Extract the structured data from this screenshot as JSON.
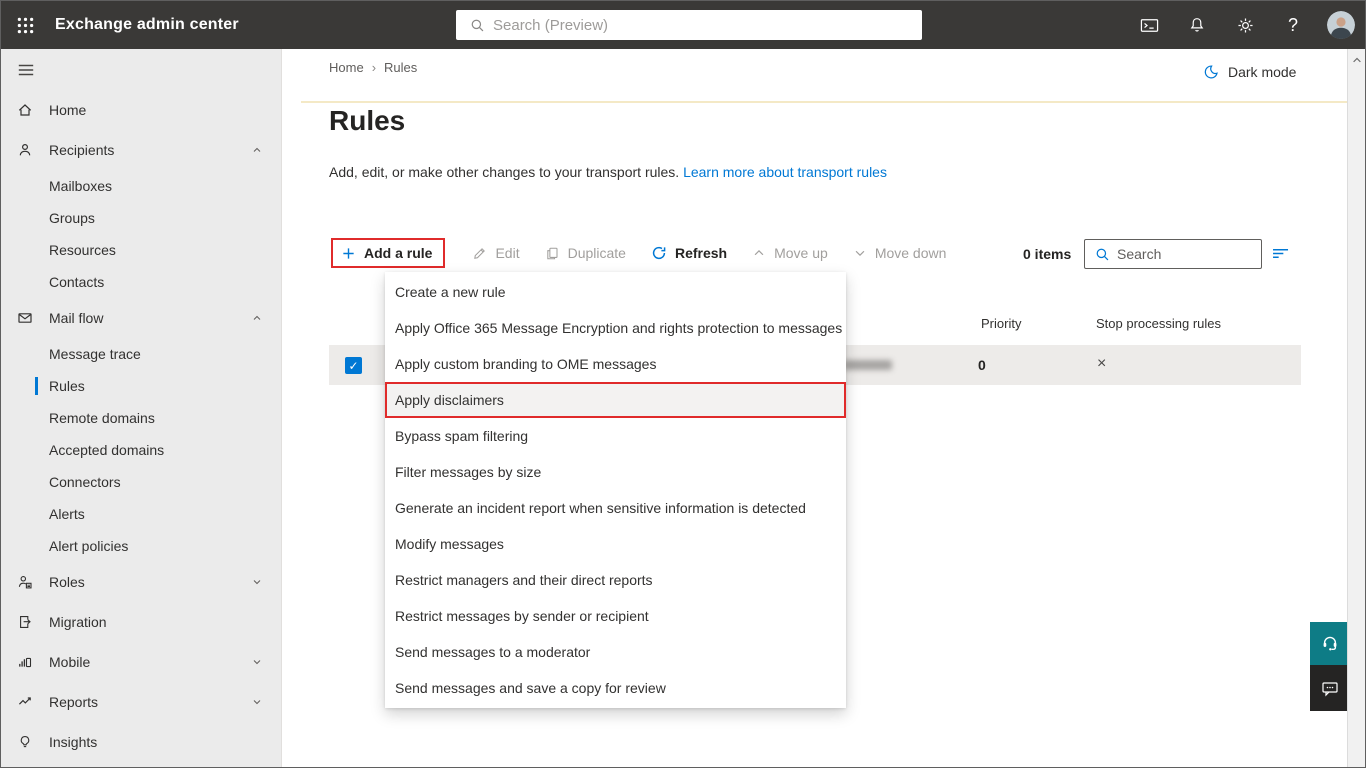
{
  "topbar": {
    "title": "Exchange admin center",
    "search_placeholder": "Search (Preview)"
  },
  "breadcrumb": {
    "items": [
      "Home",
      "Rules"
    ]
  },
  "header": {
    "dark_mode_label": "Dark mode",
    "title": "Rules",
    "description": "Add, edit, or make other changes to your transport rules.",
    "link_text": "Learn more about transport rules"
  },
  "toolbar": {
    "add_rule": "Add a rule",
    "edit": "Edit",
    "duplicate": "Duplicate",
    "refresh": "Refresh",
    "move_up": "Move up",
    "move_down": "Move down",
    "items_count": "0 items",
    "search_placeholder": "Search"
  },
  "table": {
    "headers": [
      "Priority",
      "Stop processing rules"
    ],
    "row": {
      "selected": true,
      "name_redacted": true,
      "priority": "0",
      "stop_processing": "×"
    }
  },
  "dropdown": {
    "highlighted_index": 3,
    "items": [
      "Create a new rule",
      "Apply Office 365 Message Encryption and rights protection to messages",
      "Apply custom branding to OME messages",
      "Apply disclaimers",
      "Bypass spam filtering",
      "Filter messages by size",
      "Generate an incident report when sensitive information is detected",
      "Modify messages",
      "Restrict managers and their direct reports",
      "Restrict messages by sender or recipient",
      "Send messages to a moderator",
      "Send messages and save a copy for review"
    ]
  },
  "sidebar": {
    "items": [
      {
        "label": "Home"
      },
      {
        "label": "Recipients",
        "expanded": true
      },
      {
        "label": "Mailboxes"
      },
      {
        "label": "Groups"
      },
      {
        "label": "Resources"
      },
      {
        "label": "Contacts"
      },
      {
        "label": "Mail flow",
        "expanded": true
      },
      {
        "label": "Message trace"
      },
      {
        "label": "Rules",
        "selected": true
      },
      {
        "label": "Remote domains"
      },
      {
        "label": "Accepted domains"
      },
      {
        "label": "Connectors"
      },
      {
        "label": "Alerts"
      },
      {
        "label": "Alert policies"
      },
      {
        "label": "Roles",
        "expanded": false
      },
      {
        "label": "Migration"
      },
      {
        "label": "Mobile",
        "expanded": false
      },
      {
        "label": "Reports",
        "expanded": false
      },
      {
        "label": "Insights"
      }
    ]
  },
  "icons": {
    "check": "✓",
    "breadcrumb_separator": "›",
    "help": "?"
  },
  "colors": {
    "accent": "#0078d4",
    "topbar_bg": "#3a3937",
    "sidebar_bg": "#ebebeb",
    "annotation_red": "#e02b2b",
    "selected_row_bg": "#edebe9",
    "divider_yellow": "#f4e9c6",
    "support_teal": "#0e7c86",
    "feedback_dark": "#252423"
  }
}
